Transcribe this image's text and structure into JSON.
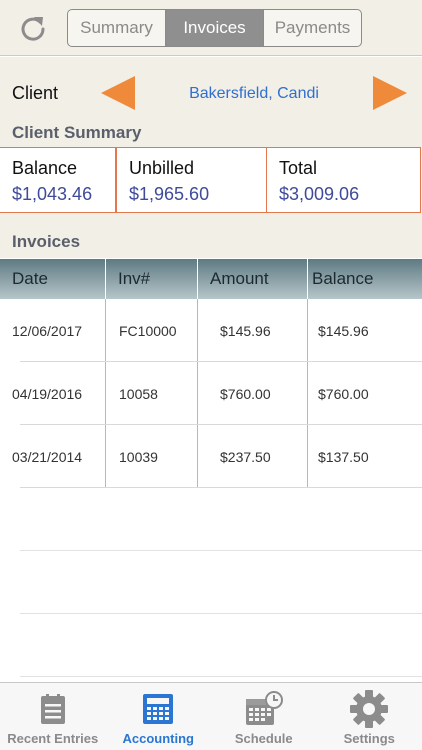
{
  "header": {
    "segments": [
      {
        "label": "Summary",
        "active": false
      },
      {
        "label": "Invoices",
        "active": true
      },
      {
        "label": "Payments",
        "active": false
      }
    ]
  },
  "client": {
    "label": "Client",
    "name": "Bakersfield, Candi"
  },
  "client_summary": {
    "title": "Client Summary",
    "balance_label": "Balance",
    "balance_value": "$1,043.46",
    "unbilled_label": "Unbilled",
    "unbilled_value": "$1,965.60",
    "total_label": "Total",
    "total_value": "$3,009.06"
  },
  "invoices": {
    "title": "Invoices",
    "columns": [
      "Date",
      "Inv#",
      "Amount",
      "Balance"
    ],
    "rows": [
      {
        "date": "12/06/2017",
        "inv": "FC10000",
        "amount": "$145.96",
        "balance": "$145.96"
      },
      {
        "date": "04/19/2016",
        "inv": "10058",
        "amount": "$760.00",
        "balance": "$760.00"
      },
      {
        "date": "03/21/2014",
        "inv": "10039",
        "amount": "$237.50",
        "balance": "$137.50"
      }
    ]
  },
  "tabbar": {
    "tabs": [
      {
        "label": "Recent Entries",
        "icon": "list-icon",
        "active": false
      },
      {
        "label": "Accounting",
        "icon": "calculator-icon",
        "active": true
      },
      {
        "label": "Schedule",
        "icon": "calendar-clock-icon",
        "active": false
      },
      {
        "label": "Settings",
        "icon": "gear-icon",
        "active": false
      }
    ]
  },
  "colors": {
    "accent": "#2a76d2",
    "arrow": "#ef8a3a",
    "summary_border": "#e07a4e",
    "value_text": "#3f4a9a"
  }
}
